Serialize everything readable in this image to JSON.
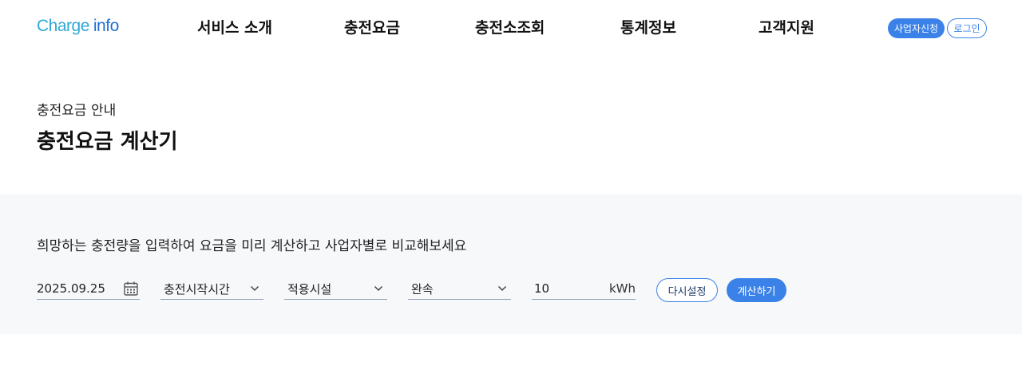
{
  "header": {
    "logo_charge": "Charge",
    "logo_info": "info",
    "nav": [
      "서비스 소개",
      "충전요금",
      "충전소조회",
      "통계정보",
      "고객지원"
    ],
    "btn_business": "사업자신청",
    "btn_login": "로그인"
  },
  "page": {
    "breadcrumb": "충전요금 안내",
    "title": "충전요금 계산기"
  },
  "calculator": {
    "description": "희망하는 충전량을 입력하여 요금을 미리 계산하고 사업자별로 비교해보세요",
    "date": "2025.09.25",
    "start_time": "충전시작시간",
    "facility": "적용시설",
    "speed": "완속",
    "kwh_value": "10",
    "kwh_unit": "kWh",
    "reset_label": "다시설정",
    "calc_label": "계산하기"
  },
  "colors": {
    "accent": "#3b82e8",
    "panel_bg": "#f7f8fa"
  }
}
